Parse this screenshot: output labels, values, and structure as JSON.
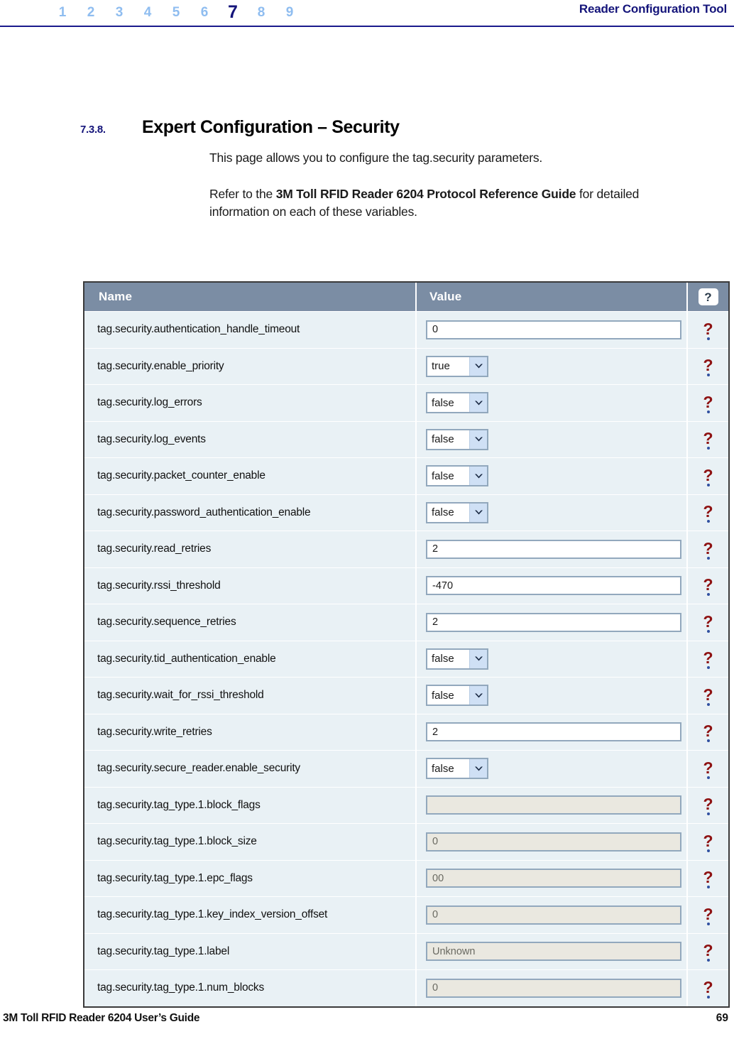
{
  "header": {
    "chapters": [
      "1",
      "2",
      "3",
      "4",
      "5",
      "6",
      "7",
      "8",
      "9"
    ],
    "current_chapter": "7",
    "title": "Reader Configuration Tool",
    "accent_color": "#14147a",
    "inactive_color": "#8fbdf0"
  },
  "section": {
    "number": "7.3.8.",
    "title": "Expert Configuration – Security"
  },
  "body": {
    "paragraph1": "This page allows you to configure the tag.security parameters.",
    "paragraph2_prefix": "Refer to the ",
    "paragraph2_bold": "3M Toll RFID Reader 6204 Protocol Reference Guide",
    "paragraph2_suffix": " for detailed information on each of these variables."
  },
  "table": {
    "header_bg": "#7b8da4",
    "row_bg": "#e9f1f5",
    "columns": [
      "Name",
      "Value",
      "?"
    ],
    "help_icon": "question-mark-icon",
    "rows": [
      {
        "name": "tag.security.authentication_handle_timeout",
        "control": "text",
        "value": "0",
        "disabled": false
      },
      {
        "name": "tag.security.enable_priority",
        "control": "select",
        "value": "true",
        "disabled": false
      },
      {
        "name": "tag.security.log_errors",
        "control": "select",
        "value": "false",
        "disabled": false
      },
      {
        "name": "tag.security.log_events",
        "control": "select",
        "value": "false",
        "disabled": false
      },
      {
        "name": "tag.security.packet_counter_enable",
        "control": "select",
        "value": "false",
        "disabled": false
      },
      {
        "name": "tag.security.password_authentication_enable",
        "control": "select",
        "value": "false",
        "disabled": false
      },
      {
        "name": "tag.security.read_retries",
        "control": "text",
        "value": "2",
        "disabled": false
      },
      {
        "name": "tag.security.rssi_threshold",
        "control": "text",
        "value": "-470",
        "disabled": false
      },
      {
        "name": "tag.security.sequence_retries",
        "control": "text",
        "value": "2",
        "disabled": false
      },
      {
        "name": "tag.security.tid_authentication_enable",
        "control": "select",
        "value": "false",
        "disabled": false
      },
      {
        "name": "tag.security.wait_for_rssi_threshold",
        "control": "select",
        "value": "false",
        "disabled": false
      },
      {
        "name": "tag.security.write_retries",
        "control": "text",
        "value": "2",
        "disabled": false
      },
      {
        "name": "tag.security.secure_reader.enable_security",
        "control": "select",
        "value": "false",
        "disabled": false
      },
      {
        "name": "tag.security.tag_type.1.block_flags",
        "control": "text",
        "value": "",
        "disabled": true
      },
      {
        "name": "tag.security.tag_type.1.block_size",
        "control": "text",
        "value": "0",
        "disabled": true
      },
      {
        "name": "tag.security.tag_type.1.epc_flags",
        "control": "text",
        "value": "00",
        "disabled": true
      },
      {
        "name": "tag.security.tag_type.1.key_index_version_offset",
        "control": "text",
        "value": "0",
        "disabled": true
      },
      {
        "name": "tag.security.tag_type.1.label",
        "control": "text",
        "value": "Unknown",
        "disabled": true
      },
      {
        "name": "tag.security.tag_type.1.num_blocks",
        "control": "text",
        "value": "0",
        "disabled": true
      }
    ],
    "select_options": [
      "true",
      "false"
    ]
  },
  "footer": {
    "left": "3M Toll RFID Reader 6204 User’s Guide",
    "page_number": "69"
  }
}
